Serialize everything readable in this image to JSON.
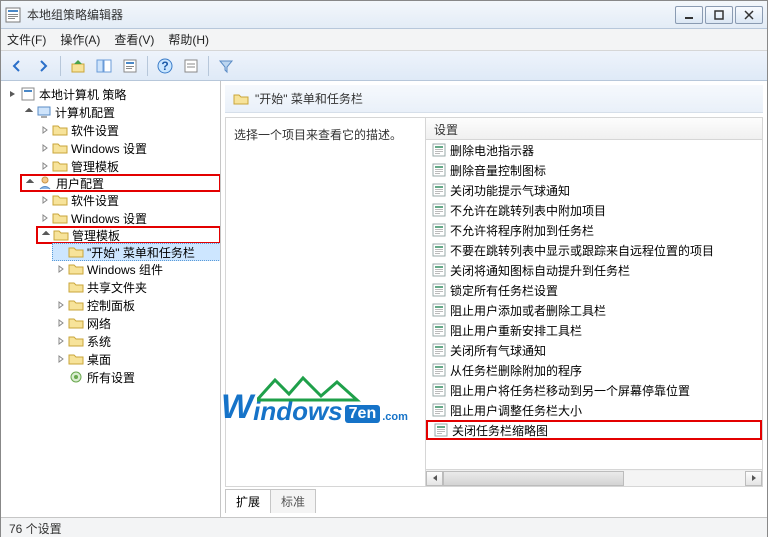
{
  "window": {
    "title": "本地组策略编辑器"
  },
  "menu": {
    "file": "文件(F)",
    "action": "操作(A)",
    "view": "查看(V)",
    "help": "帮助(H)"
  },
  "tree": {
    "root": "本地计算机 策略",
    "computer_config": "计算机配置",
    "cc_software": "软件设置",
    "cc_windows": "Windows 设置",
    "cc_admin": "管理模板",
    "user_config": "用户配置",
    "uc_software": "软件设置",
    "uc_windows": "Windows 设置",
    "uc_admin": "管理模板",
    "start_taskbar": "\"开始\" 菜单和任务栏",
    "win_components": "Windows 组件",
    "shared_folders": "共享文件夹",
    "control_panel": "控制面板",
    "network": "网络",
    "system": "系统",
    "desktop": "桌面",
    "all_settings": "所有设置"
  },
  "detail": {
    "header": "\"开始\" 菜单和任务栏",
    "desc": "选择一个项目来查看它的描述。",
    "col_header": "设置",
    "items": [
      "删除电池指示器",
      "删除音量控制图标",
      "关闭功能提示气球通知",
      "不允许在跳转列表中附加项目",
      "不允许将程序附加到任务栏",
      "不要在跳转列表中显示或跟踪来自远程位置的项目",
      "关闭将通知图标自动提升到任务栏",
      "锁定所有任务栏设置",
      "阻止用户添加或者删除工具栏",
      "阻止用户重新安排工具栏",
      "关闭所有气球通知",
      "从任务栏删除附加的程序",
      "阻止用户将任务栏移动到另一个屏幕停靠位置",
      "阻止用户调整任务栏大小",
      "关闭任务栏缩略图"
    ]
  },
  "tabs": {
    "extended": "扩展",
    "standard": "标准"
  },
  "status": {
    "text": "76 个设置"
  },
  "watermark": {
    "brand_w": "W",
    "brand_tail": "indows",
    "seven": "7en",
    "dotcom": ".com"
  }
}
